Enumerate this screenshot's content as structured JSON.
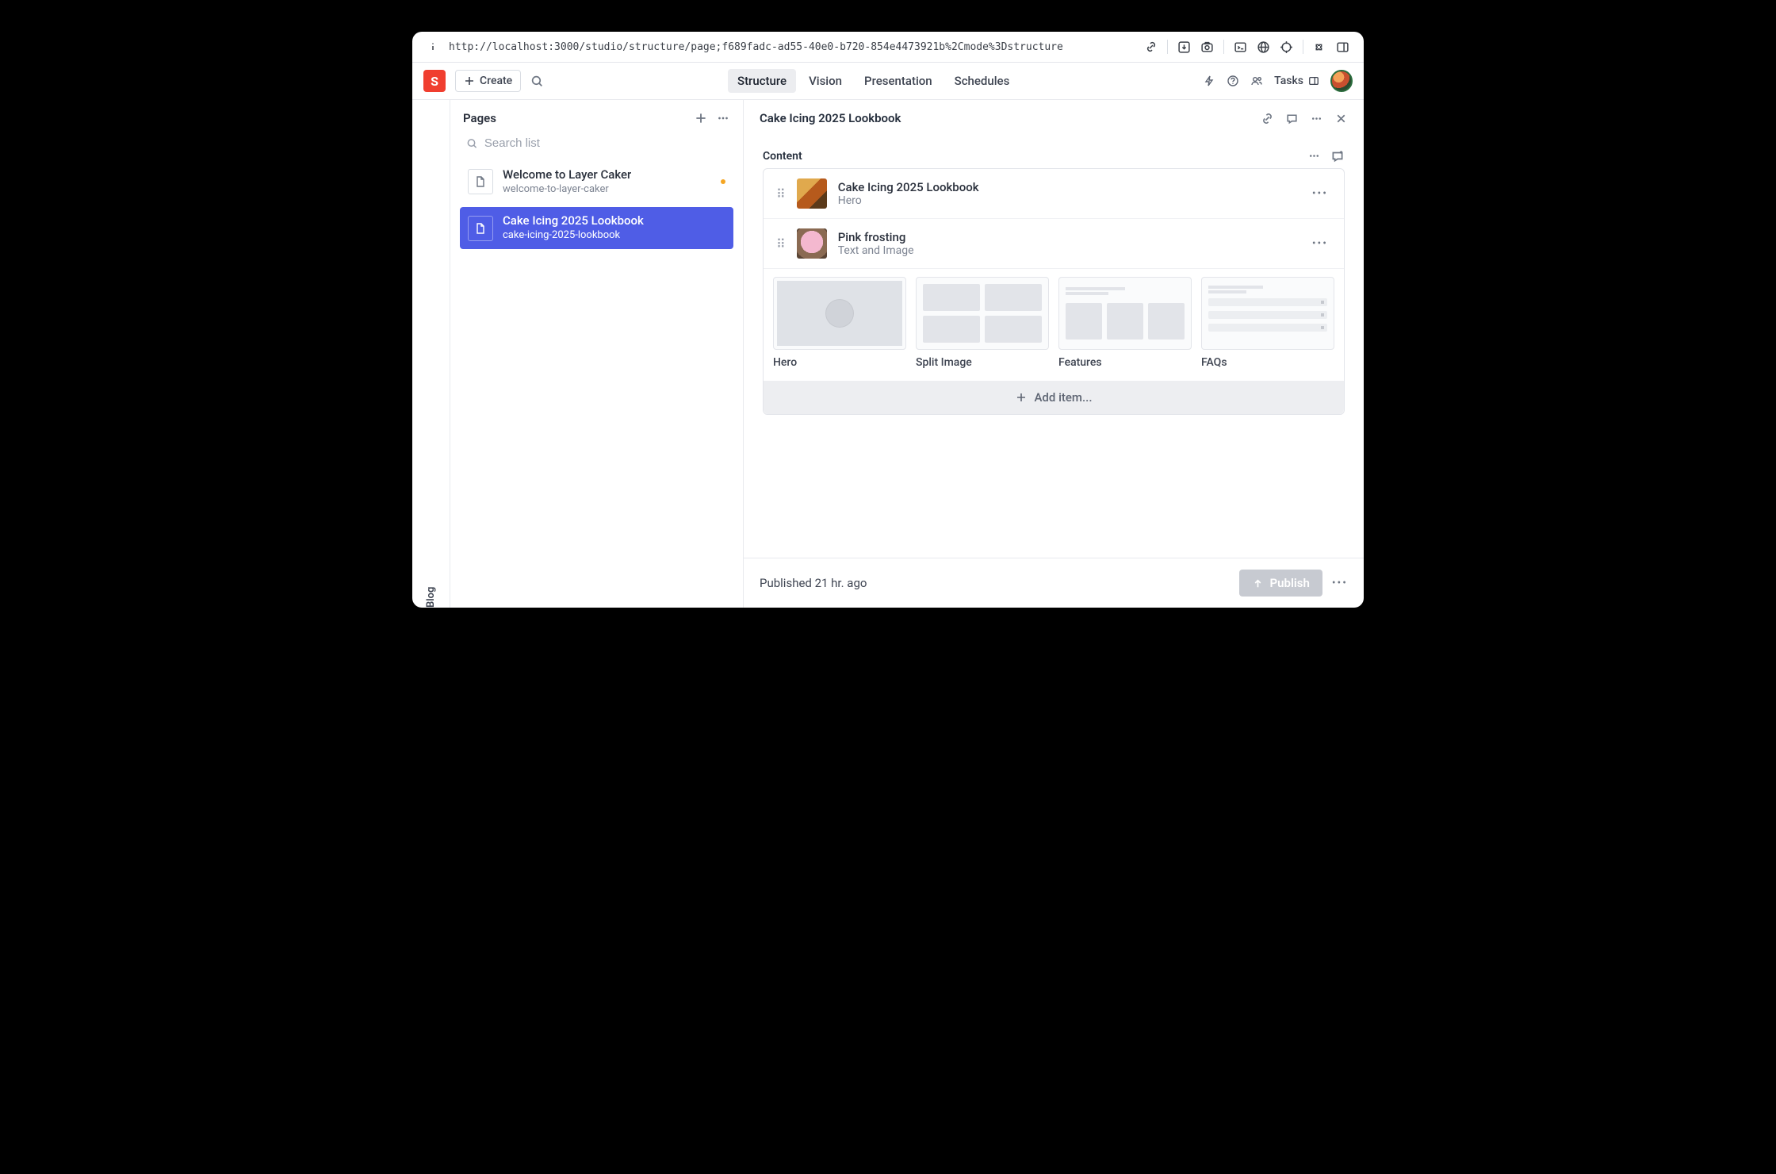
{
  "urlbar": {
    "url": "http://localhost:3000/studio/structure/page;f689fadc-ad55-40e0-b720-854e4473921b%2Cmode%3Dstructure"
  },
  "toolbar": {
    "logo_letter": "S",
    "create_label": "Create",
    "tabs": [
      "Structure",
      "Vision",
      "Presentation",
      "Schedules"
    ],
    "active_tab_index": 0,
    "tasks_label": "Tasks"
  },
  "rail": {
    "label": "Blog"
  },
  "pages_column": {
    "title": "Pages",
    "search_placeholder": "Search list",
    "items": [
      {
        "title": "Welcome to Layer Caker",
        "slug": "welcome-to-layer-caker",
        "selected": false,
        "has_draft_dot": true
      },
      {
        "title": "Cake Icing 2025 Lookbook",
        "slug": "cake-icing-2025-lookbook",
        "selected": true,
        "has_draft_dot": false
      }
    ]
  },
  "document": {
    "title": "Cake Icing 2025 Lookbook",
    "section_label": "Content",
    "blocks": [
      {
        "title": "Cake Icing 2025 Lookbook",
        "type_label": "Hero",
        "thumb": "hero"
      },
      {
        "title": "Pink frosting",
        "type_label": "Text and Image",
        "thumb": "pink"
      }
    ],
    "templates": [
      {
        "label": "Hero",
        "preview": "hero-p"
      },
      {
        "label": "Split Image",
        "preview": "split"
      },
      {
        "label": "Features",
        "preview": "features"
      },
      {
        "label": "FAQs",
        "preview": "faqs"
      }
    ],
    "add_item_label": "Add item...",
    "published_status": "Published 21 hr. ago",
    "publish_label": "Publish"
  }
}
